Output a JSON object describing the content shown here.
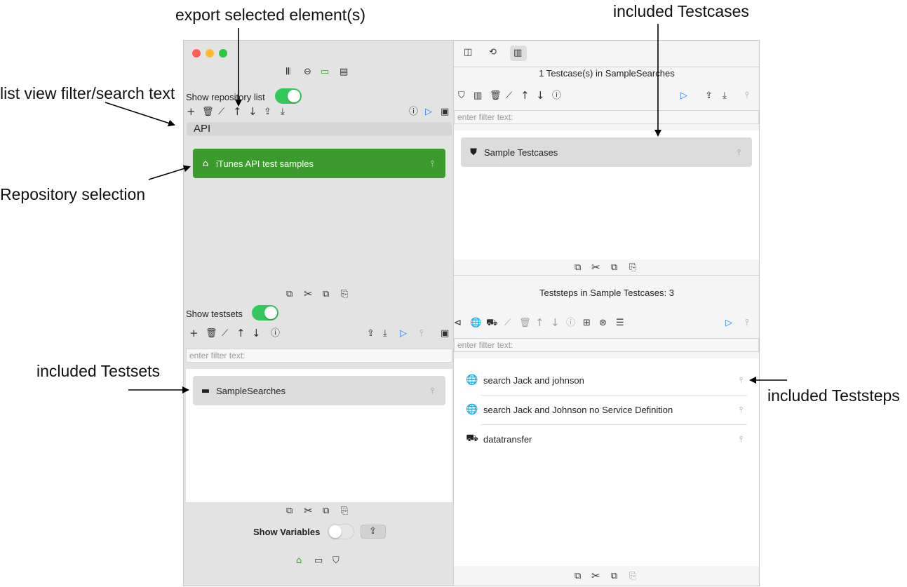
{
  "annotations": {
    "export_selected": "export selected element(s)",
    "included_testcases": "included Testcases",
    "list_filter": "list view filter/search text",
    "repository_selection": "Repository selection",
    "included_testsets": "included Testsets",
    "included_teststeps": "included Teststeps"
  },
  "left": {
    "show_repository_list": "Show repository list",
    "search_text": "API",
    "repository": "iTunes API test samples",
    "show_testsets": "Show testsets",
    "testset_filter_placeholder": "enter filter text:",
    "testset": "SampleSearches",
    "show_variables": "Show Variables"
  },
  "right": {
    "testcase_header": "1 Testcase(s) in SampleSearches",
    "testcase_filter_placeholder": "enter filter text:",
    "testcase": "Sample Testcases",
    "teststeps_header": "Teststeps in Sample Testcases: 3",
    "teststep_filter_placeholder": "enter filter text:",
    "teststeps": [
      "search Jack and johnson",
      "search Jack and Johnson no Service Definition",
      "datatransfer"
    ]
  },
  "colors": {
    "accent_green": "#3c9b2d",
    "toggle_green": "#34c759",
    "accent_blue": "#2f7cf6"
  }
}
